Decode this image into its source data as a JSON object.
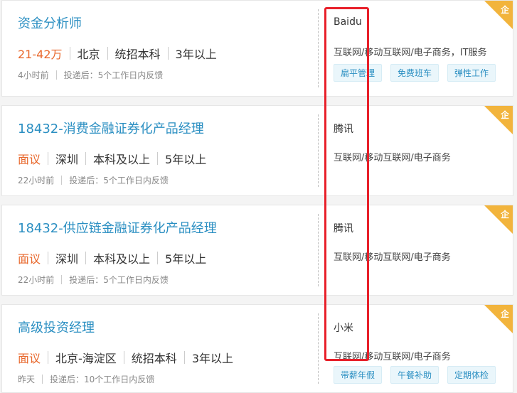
{
  "corner_badge": "企",
  "jobs": [
    {
      "title": "资金分析师",
      "salary": "21-42万",
      "city": "北京",
      "education": "统招本科",
      "experience": "3年以上",
      "posted": "4小时前",
      "feedback": "投递后：5个工作日内反馈",
      "company": "Baidu",
      "industry": "互联网/移动互联网/电子商务，IT服务",
      "tags": [
        "扁平管理",
        "免费班车",
        "弹性工作"
      ]
    },
    {
      "title": "18432-消费金融证券化产品经理",
      "salary": "面议",
      "city": "深圳",
      "education": "本科及以上",
      "experience": "5年以上",
      "posted": "22小时前",
      "feedback": "投递后：5个工作日内反馈",
      "company": "腾讯",
      "industry": "互联网/移动互联网/电子商务",
      "tags": []
    },
    {
      "title": "18432-供应链金融证券化产品经理",
      "salary": "面议",
      "city": "深圳",
      "education": "本科及以上",
      "experience": "5年以上",
      "posted": "22小时前",
      "feedback": "投递后：5个工作日内反馈",
      "company": "腾讯",
      "industry": "互联网/移动互联网/电子商务",
      "tags": []
    },
    {
      "title": "高级投资经理",
      "salary": "面议",
      "city": "北京-海淀区",
      "education": "统招本科",
      "experience": "3年以上",
      "posted": "昨天",
      "feedback": "投递后：10个工作日内反馈",
      "company": "小米",
      "industry": "互联网/移动互联网/电子商务",
      "tags": [
        "带薪年假",
        "午餐补助",
        "定期体检"
      ]
    }
  ]
}
